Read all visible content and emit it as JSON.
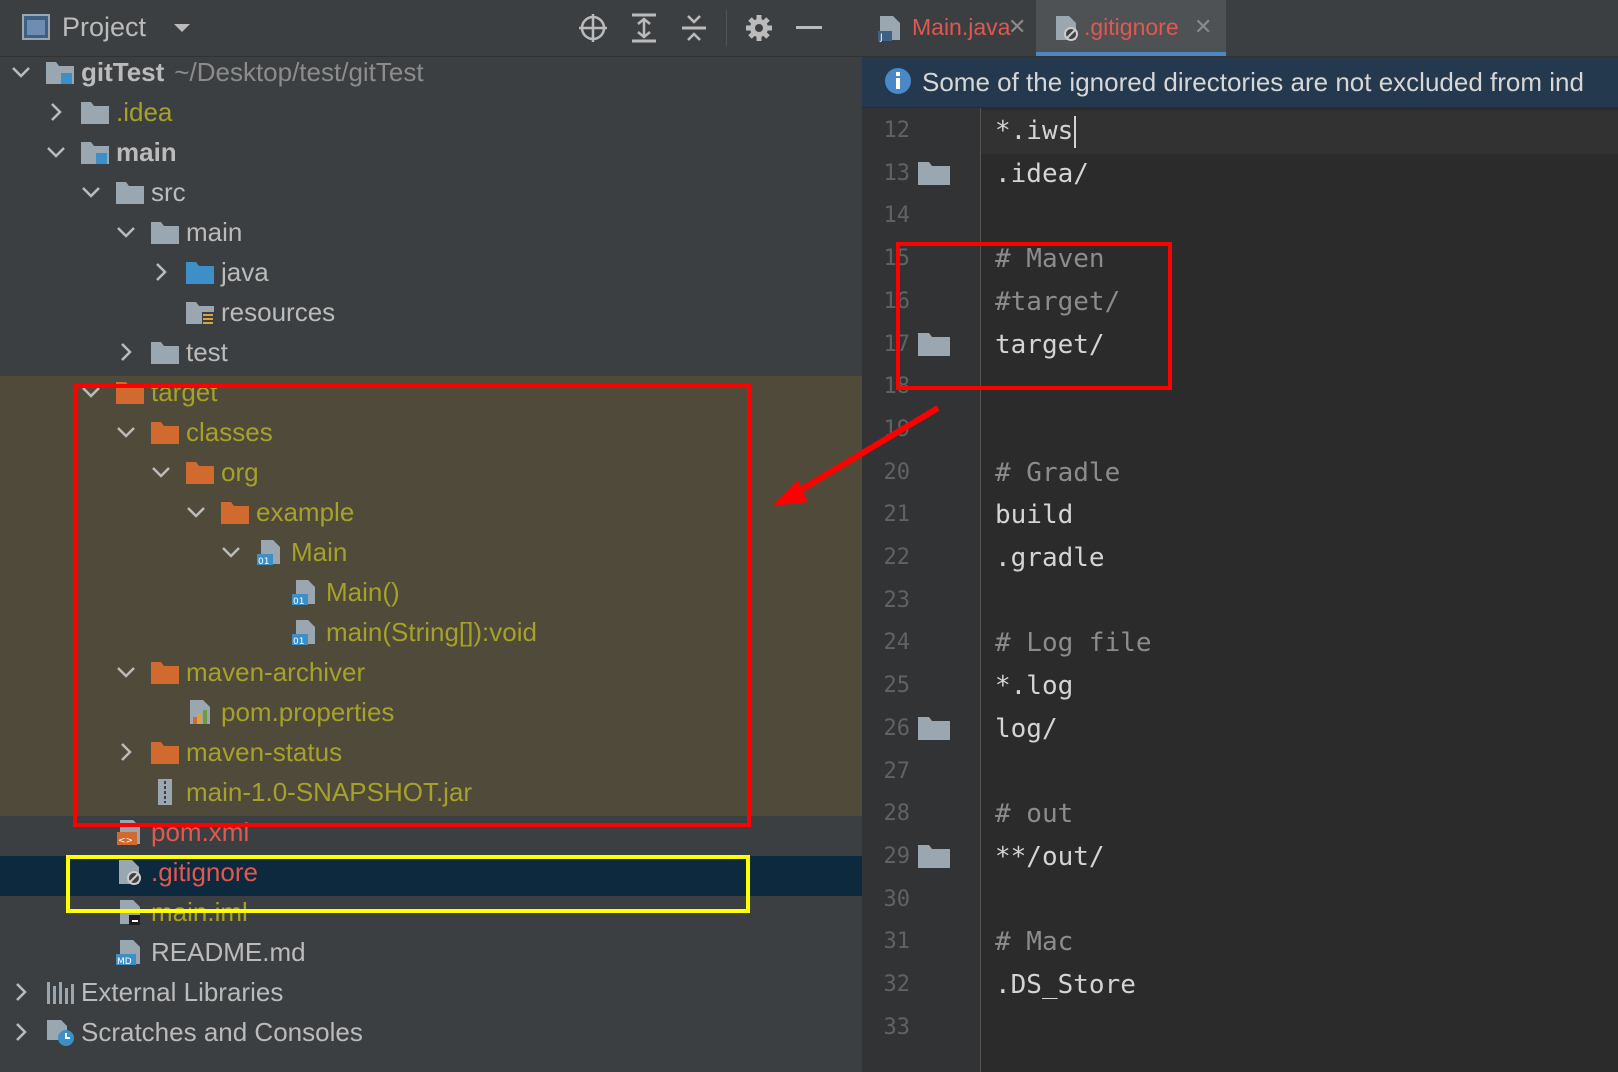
{
  "project_panel": {
    "title": "Project",
    "toolbar_icons": [
      "locate-icon",
      "expand-all-icon",
      "collapse-all-icon",
      "gear-icon",
      "minimize-icon"
    ],
    "tree": [
      {
        "label": "gitTest",
        "hint": "~/Desktop/test/gitTest",
        "icon": "module-folder-icon",
        "expanded": true
      },
      {
        "label": ".idea",
        "icon": "folder-icon",
        "expanded": false
      },
      {
        "label": "main",
        "icon": "module-folder-icon",
        "expanded": true
      },
      {
        "label": "src",
        "icon": "folder-icon",
        "expanded": true
      },
      {
        "label": "main",
        "icon": "folder-icon",
        "expanded": true
      },
      {
        "label": "java",
        "icon": "source-folder-icon",
        "expanded": false
      },
      {
        "label": "resources",
        "icon": "resources-folder-icon"
      },
      {
        "label": "test",
        "icon": "folder-icon",
        "expanded": false
      },
      {
        "label": "target",
        "icon": "excluded-folder-icon",
        "expanded": true
      },
      {
        "label": "classes",
        "icon": "excluded-folder-icon",
        "expanded": true
      },
      {
        "label": "org",
        "icon": "excluded-folder-icon",
        "expanded": true
      },
      {
        "label": "example",
        "icon": "excluded-folder-icon",
        "expanded": true
      },
      {
        "label": "Main",
        "icon": "class-file-icon",
        "expanded": true
      },
      {
        "label": "Main()",
        "icon": "class-file-icon"
      },
      {
        "label": "main(String[]):void",
        "icon": "class-file-icon"
      },
      {
        "label": "maven-archiver",
        "icon": "excluded-folder-icon",
        "expanded": true
      },
      {
        "label": "pom.properties",
        "icon": "properties-file-icon"
      },
      {
        "label": "maven-status",
        "icon": "excluded-folder-icon",
        "expanded": false
      },
      {
        "label": "main-1.0-SNAPSHOT.jar",
        "icon": "jar-file-icon"
      },
      {
        "label": "pom.xml",
        "icon": "xml-file-icon"
      },
      {
        "label": ".gitignore",
        "icon": "gitignore-file-icon"
      },
      {
        "label": "main.iml",
        "icon": "iml-file-icon"
      },
      {
        "label": "README.md",
        "icon": "markdown-file-icon"
      },
      {
        "label": "External Libraries",
        "icon": "libraries-icon",
        "expanded": false
      },
      {
        "label": "Scratches and Consoles",
        "icon": "scratches-icon",
        "expanded": false
      }
    ]
  },
  "editor": {
    "tabs": [
      {
        "label": "Main.java",
        "icon": "java-file-icon",
        "active": false
      },
      {
        "label": ".gitignore",
        "icon": "gitignore-file-icon",
        "active": true
      }
    ],
    "banner": {
      "icon": "info-icon",
      "text": "Some of the ignored directories are not excluded from ind"
    },
    "lines": [
      {
        "n": "12",
        "text": "*.iws",
        "fold": false
      },
      {
        "n": "13",
        "text": ".idea/",
        "fold": true
      },
      {
        "n": "14",
        "text": "",
        "fold": false
      },
      {
        "n": "15",
        "text": "# Maven",
        "fold": false
      },
      {
        "n": "16",
        "text": "#target/",
        "fold": false
      },
      {
        "n": "17",
        "text": "target/",
        "fold": true
      },
      {
        "n": "18",
        "text": "",
        "fold": false
      },
      {
        "n": "19",
        "text": "",
        "fold": false
      },
      {
        "n": "20",
        "text": "# Gradle",
        "fold": false
      },
      {
        "n": "21",
        "text": "build",
        "fold": false
      },
      {
        "n": "22",
        "text": ".gradle",
        "fold": false
      },
      {
        "n": "23",
        "text": "",
        "fold": false
      },
      {
        "n": "24",
        "text": "# Log file",
        "fold": false
      },
      {
        "n": "25",
        "text": "*.log",
        "fold": false
      },
      {
        "n": "26",
        "text": "log/",
        "fold": true
      },
      {
        "n": "27",
        "text": "",
        "fold": false
      },
      {
        "n": "28",
        "text": "# out",
        "fold": false
      },
      {
        "n": "29",
        "text": "**/out/",
        "fold": true
      },
      {
        "n": "30",
        "text": "",
        "fold": false
      },
      {
        "n": "31",
        "text": "# Mac",
        "fold": false
      },
      {
        "n": "32",
        "text": ".DS_Store",
        "fold": false
      },
      {
        "n": "33",
        "text": "",
        "fold": false
      }
    ]
  },
  "colors": {
    "panel_bg": "#3c3f41",
    "editor_bg": "#2b2b2b",
    "ignored_text": "#a6a12a",
    "ignored_bg": "#4f4a3a",
    "selection_bg": "#0d293e",
    "annotation_red": "#ff0000",
    "annotation_yellow": "#ffff00",
    "excluded_folder": "#d16a2e"
  }
}
